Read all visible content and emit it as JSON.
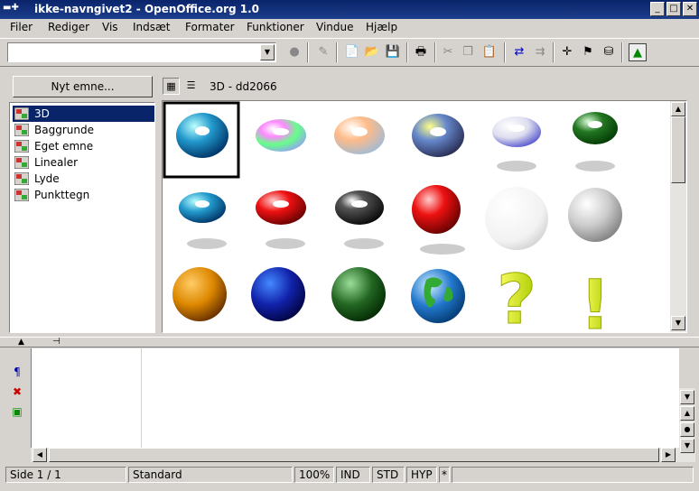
{
  "window": {
    "title": "ikke-navngivet2 - OpenOffice.org 1.0"
  },
  "menu": [
    "Filer",
    "Rediger",
    "Vis",
    "Indsæt",
    "Formater",
    "Funktioner",
    "Vindue",
    "Hjælp"
  ],
  "toolbar": {
    "combo_value": ""
  },
  "gallery": {
    "new_theme_label": "Nyt emne...",
    "title": "3D - dd2066",
    "themes": [
      "3D",
      "Baggrunde",
      "Eget emne",
      "Linealer",
      "Lyde",
      "Punkttegn"
    ],
    "selected_theme": "3D"
  },
  "statusbar": {
    "page": "Side 1 / 1",
    "style": "Standard",
    "zoom": "100%",
    "insert": "IND",
    "select": "STD",
    "hyperlink": "HYP",
    "modified": "*"
  }
}
